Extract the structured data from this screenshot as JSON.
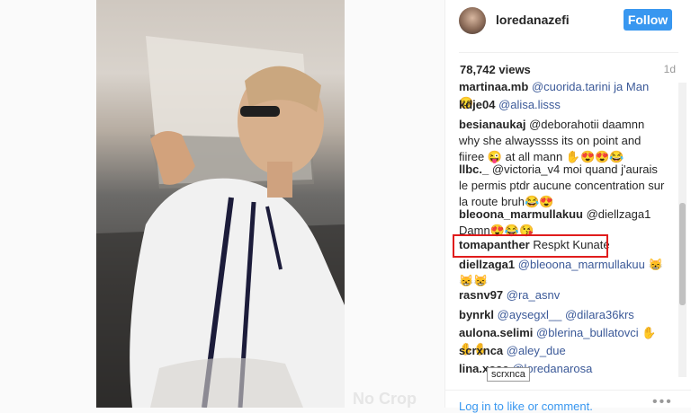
{
  "post": {
    "username": "loredanazefi",
    "follow_label": "Follow",
    "views": "78,742 views",
    "age": "1d"
  },
  "comments": [
    {
      "user": "martinaa.mb",
      "text": "@cuorida.tarini ja Man 😊"
    },
    {
      "user": "kdje04",
      "text": "@alisa.lisss"
    },
    {
      "user": "besianaukaj",
      "text": "@deborahotii daamnn why she alwayssss its on point and fiiree 😜 at all mann ✋😍😍😂"
    },
    {
      "user": "llbc._",
      "text": "@victoria_v4 moi quand j'aurais le permis ptdr aucune concentration sur la route bruh😂😍"
    },
    {
      "user": "bleoona_marmullakuu",
      "text": "@diellzaga1 Damn😍😂😘"
    },
    {
      "user": "tomapanther",
      "text": "Respkt Kunaté"
    },
    {
      "user": "diellzaga1",
      "text": "@bleoona_marmullakuu 😸😸😸"
    },
    {
      "user": "rasnv97",
      "text": "@ra_asnv"
    },
    {
      "user": "bynrkl",
      "text": "@aysegxl__ @dilara36krs"
    },
    {
      "user": "aulona.selimi",
      "text": "@blerina_bullatovci ✋✋✋"
    },
    {
      "user": "scrxnca",
      "text": "@aley_due"
    },
    {
      "user": "lina.xose",
      "text": "@loredanarosa"
    }
  ],
  "tooltip": "scrxnca",
  "footer": {
    "login_text": "Log in to like or comment.",
    "more_icon": "more-options-icon"
  },
  "watermark": "No Crop",
  "colors": {
    "accent": "#3897f0",
    "highlight_border": "#e01c1c"
  }
}
